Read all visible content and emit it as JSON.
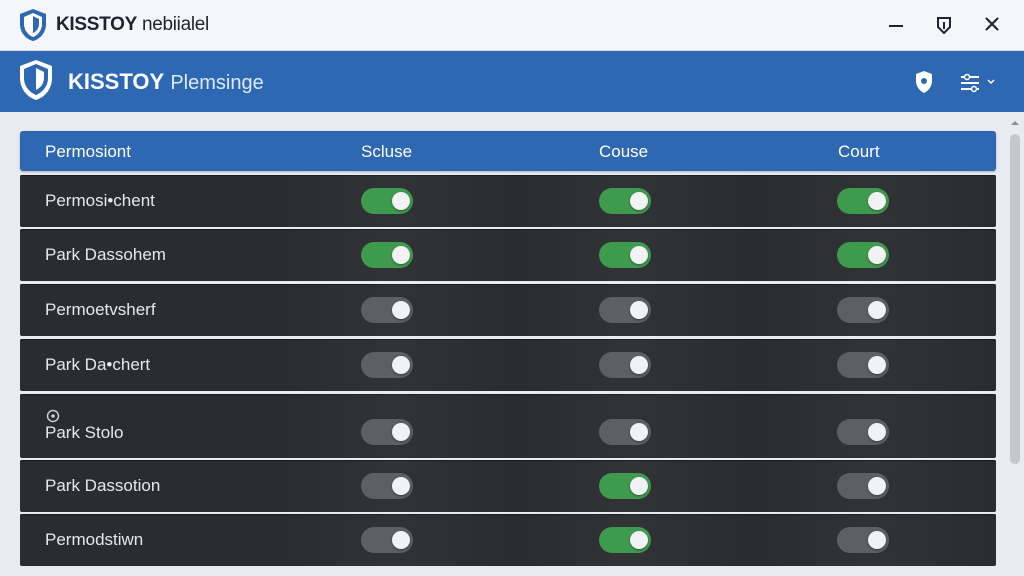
{
  "window": {
    "title_brand": "KISSTOY",
    "title_rest": "nebiialel"
  },
  "header": {
    "brand": "KISSTOY",
    "subtitle": "Plemsinge"
  },
  "table": {
    "columns": [
      "Permosiont",
      "Scluse",
      "Couse",
      "Court"
    ],
    "rows": [
      {
        "label": "Permosi•chent",
        "toggles": [
          true,
          true,
          true
        ],
        "has_icon": false
      },
      {
        "label": "Park Dassohem",
        "toggles": [
          true,
          true,
          true
        ],
        "has_icon": false
      },
      {
        "label": "Permoetvsherf",
        "toggles": [
          false,
          false,
          false
        ],
        "has_icon": false
      },
      {
        "label": "Park Da•chert",
        "toggles": [
          false,
          false,
          false
        ],
        "has_icon": false
      },
      {
        "label": "Park Stolo",
        "toggles": [
          false,
          false,
          false
        ],
        "has_icon": true
      },
      {
        "label": "Park Dassotion",
        "toggles": [
          false,
          true,
          false
        ],
        "has_icon": false
      },
      {
        "label": "Permodstiwn",
        "toggles": [
          false,
          true,
          false
        ],
        "has_icon": false
      }
    ]
  },
  "colors": {
    "accent": "#2e68b3",
    "toggle_on": "#3e9b4d",
    "toggle_off": "#5d6063",
    "row_bg": "#2a2c2f"
  },
  "icons": {
    "title_logo": "shield-logo-icon",
    "header_logo": "shield-logo-icon",
    "header_action_1": "shield-badge-icon",
    "header_action_2": "sliders-menu-icon",
    "minimize": "minimize-icon",
    "restore": "restore-icon",
    "close": "close-icon",
    "row_icon": "refresh-icon"
  }
}
